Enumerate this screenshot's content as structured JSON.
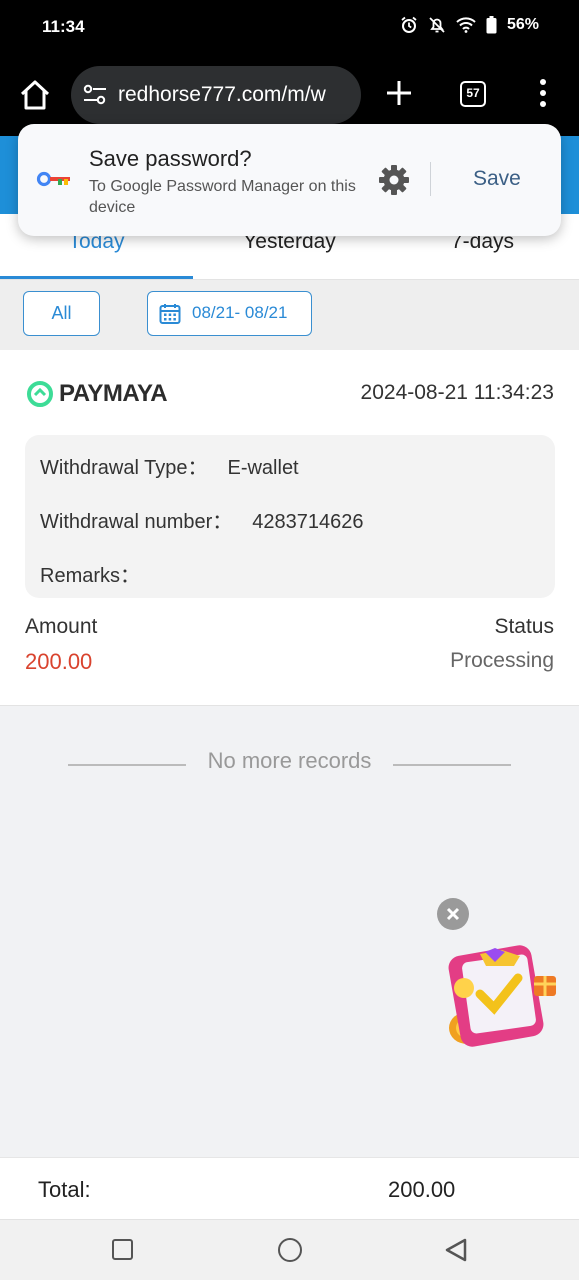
{
  "status_bar": {
    "time": "11:34",
    "battery": "56%"
  },
  "browser": {
    "url": "redhorse777.com/m/w",
    "tab_count": "57"
  },
  "save_password": {
    "title": "Save password?",
    "subtitle": "To Google Password Manager on this device",
    "save_label": "Save"
  },
  "tabs": [
    {
      "label": "Today",
      "active": true
    },
    {
      "label": "Yesterday",
      "active": false
    },
    {
      "label": "7-days",
      "active": false
    }
  ],
  "filters": {
    "all_label": "All",
    "date_range": "08/21- 08/21"
  },
  "record": {
    "provider": "PAYMAYA",
    "datetime": "2024-08-21 11:34:23",
    "type_label": "Withdrawal Type：",
    "type_value": "E-wallet",
    "number_label": "Withdrawal number：",
    "number_value": "4283714626",
    "remarks_label": "Remarks：",
    "remarks_value": "",
    "amount_label": "Amount",
    "amount_value": "200.00",
    "status_label": "Status",
    "status_value": "Processing"
  },
  "no_more_text": "No more records",
  "total": {
    "label": "Total:",
    "value": "200.00"
  },
  "colors": {
    "accent": "#2a8ad6",
    "amount": "#d9432e",
    "header_blue": "#1e8fd8"
  }
}
